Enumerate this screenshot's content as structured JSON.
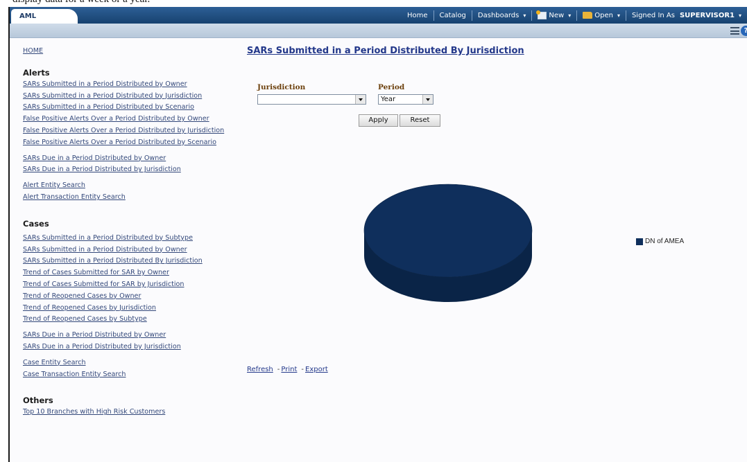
{
  "doc_text": "display data for a week or a year.",
  "app_tab": "AML",
  "nav": {
    "home": "Home",
    "catalog": "Catalog",
    "dashboards": "Dashboards",
    "new": "New",
    "open": "Open",
    "signed_in_as": "Signed In As",
    "user": "SUPERVISOR1"
  },
  "sidebar": {
    "home": "HOME",
    "alerts_heading": "Alerts",
    "alerts_group1": [
      "SARs Submitted in a Period Distributed by Owner",
      "SARs Submitted in a Period Distributed by Jurisdiction",
      "SARs Submitted in a Period Distributed by Scenario",
      "False Positive Alerts Over a Period Distributed by Owner",
      "False Positive Alerts Over a Period Distributed by Jurisdiction",
      "False Positive Alerts Over a Period Distributed by Scenario"
    ],
    "alerts_group2": [
      "SARs Due in a Period Distributed by Owner",
      "SARs Due in a Period Distributed by Jurisdiction"
    ],
    "alerts_group3": [
      "Alert Entity Search",
      "Alert Transaction Entity Search"
    ],
    "cases_heading": "Cases",
    "cases_group1": [
      "SARs Submitted in a Period Distributed by Subtype",
      "SARs Submitted in a Period Distributed by Owner",
      "SARs Submitted in a Period Distributed By Jurisdiction",
      "Trend of Cases Submitted for SAR by Owner",
      "Trend of Cases Submitted for SAR by Jurisdiction",
      "Trend of Reopened Cases by Owner",
      "Trend of Reopened Cases by Jurisdiction",
      "Trend of Reopened Cases by Subtype"
    ],
    "cases_group2": [
      "SARs Due in a Period Distributed by Owner",
      "SARs Due in a Period Distributed by Jurisdiction"
    ],
    "cases_group3": [
      "Case Entity Search",
      "Case Transaction Entity Search"
    ],
    "others_heading": "Others",
    "others_group1": [
      "Top 10 Branches with High Risk Customers"
    ]
  },
  "report": {
    "title": "SARs Submitted in a Period Distributed By Jurisdiction",
    "jurisdiction_label": "Jurisdiction",
    "jurisdiction_value": "",
    "period_label": "Period",
    "period_value": "Year",
    "apply": "Apply",
    "reset": "Reset"
  },
  "chart_data": {
    "type": "pie",
    "slices": [
      {
        "label": "DN of AMEA",
        "value": 100,
        "color": "#0f2f5c"
      }
    ],
    "legend_position": "right"
  },
  "footer": {
    "refresh": "Refresh",
    "print": "Print",
    "export": "Export",
    "separator": "-"
  },
  "colors": {
    "nav_bar": "#1f4c7e",
    "link": "#33487a",
    "title": "#23388a",
    "label": "#6b3f0b",
    "pie_top": "#0f2f5c",
    "pie_side": "#0a2447"
  }
}
